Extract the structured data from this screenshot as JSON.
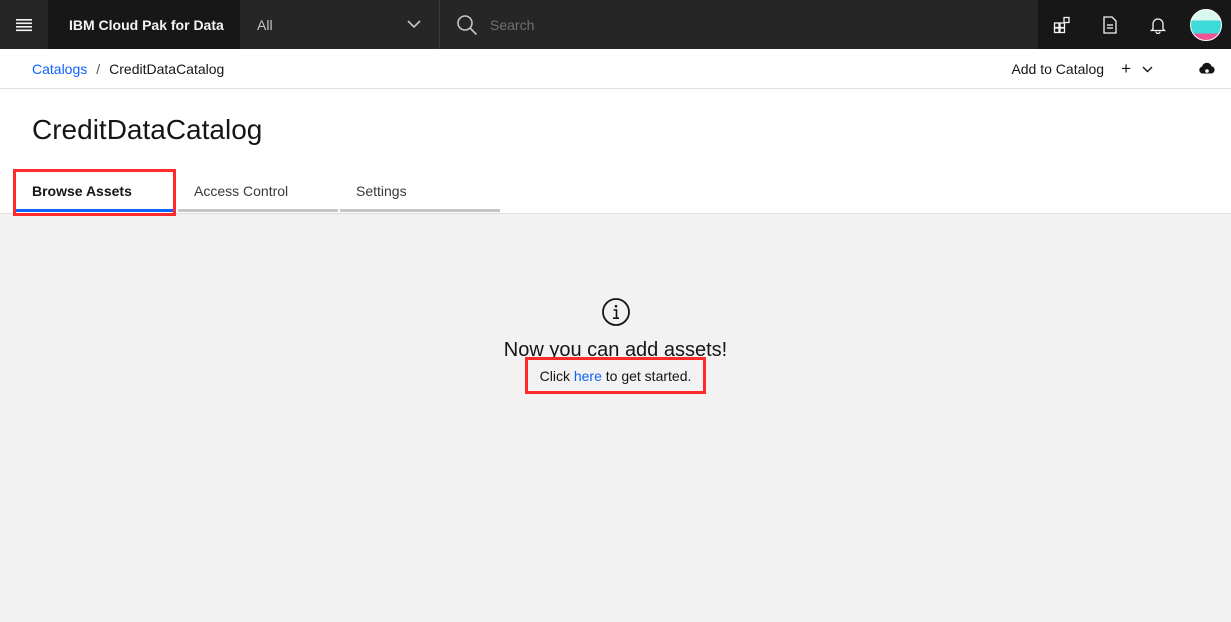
{
  "header": {
    "brand": "IBM Cloud Pak for Data",
    "scope_value": "All",
    "search_placeholder": "Search",
    "icons": [
      "menu-icon",
      "chevron-down-icon",
      "search-icon",
      "apps-icon",
      "document-icon",
      "notification-icon",
      "avatar"
    ]
  },
  "breadcrumb": {
    "parent": "Catalogs",
    "separator": "/",
    "current": "CreditDataCatalog"
  },
  "actions": {
    "add_to_catalog": "Add to Catalog",
    "plus": "+",
    "icons": [
      "add-icon",
      "chevron-down-icon",
      "cloud-icon"
    ]
  },
  "page": {
    "title": "CreditDataCatalog"
  },
  "tabs": [
    {
      "label": "Browse Assets",
      "active": true
    },
    {
      "label": "Access Control",
      "active": false
    },
    {
      "label": "Settings",
      "active": false
    }
  ],
  "empty_state": {
    "icon": "info-icon",
    "heading": "Now you can add assets!",
    "sub_before": "Click ",
    "link_text": "here",
    "sub_after": " to get started."
  },
  "colors": {
    "header_bg": "#171717",
    "link": "#0f62fe",
    "highlight": "#ff2a2a",
    "content_bg": "#f2f2f2"
  }
}
